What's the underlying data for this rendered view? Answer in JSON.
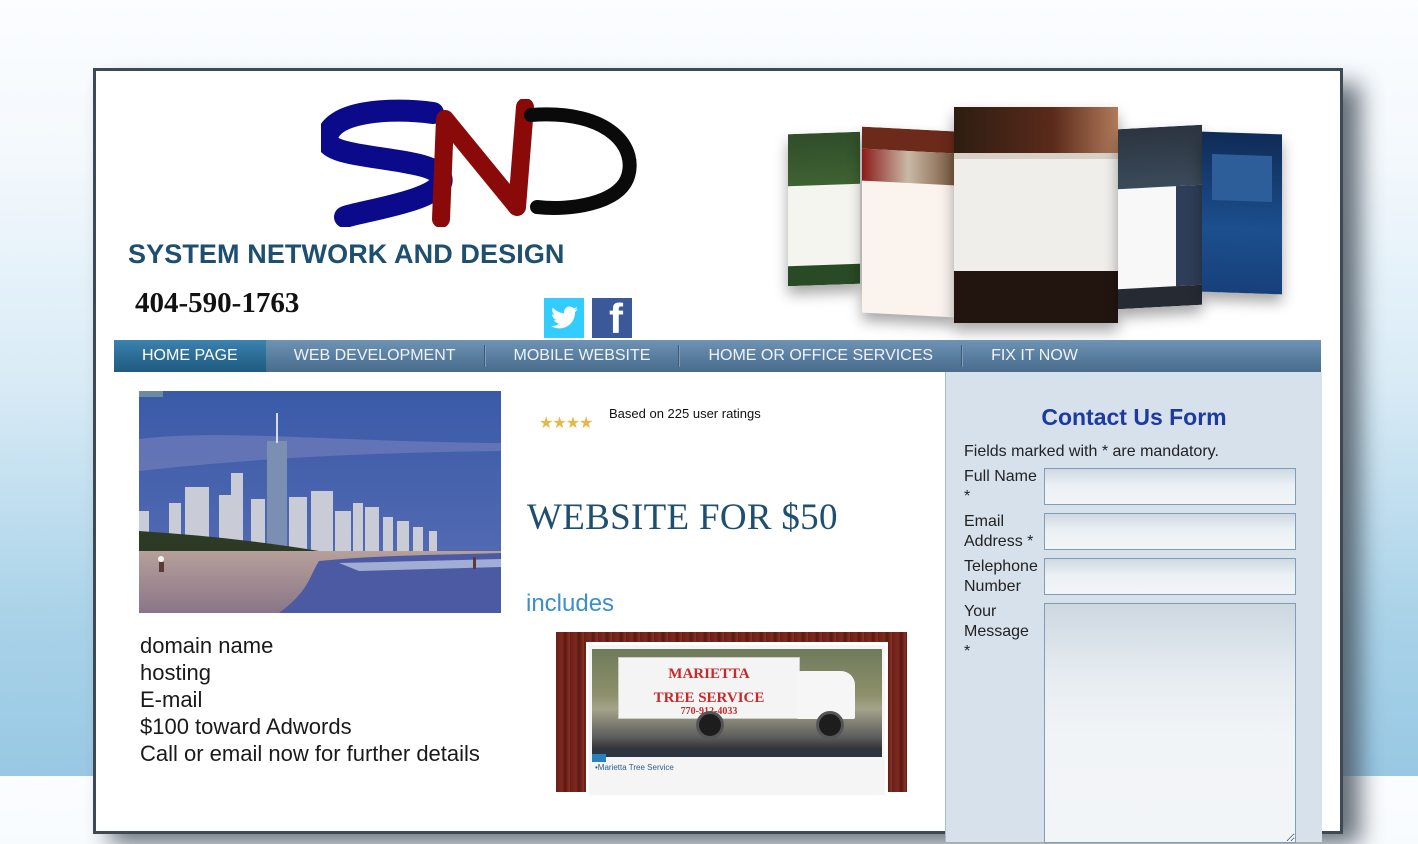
{
  "header": {
    "logo_letters": "SND",
    "site_title": "SYSTEM NETWORK AND DESIGN",
    "phone": "404-590-1763",
    "social": [
      {
        "name": "twitter",
        "icon": "twitter-bird-icon"
      },
      {
        "name": "facebook",
        "icon": "facebook-f-icon",
        "glyph": "f"
      }
    ]
  },
  "nav": {
    "items": [
      {
        "label": "HOME PAGE",
        "active": true
      },
      {
        "label": "WEB DEVELOPMENT",
        "active": false
      },
      {
        "label": "MOBILE WEBSITE",
        "active": false
      },
      {
        "label": "HOME OR OFFICE SERVICES",
        "active": false
      },
      {
        "label": "FIX IT NOW",
        "active": false
      }
    ]
  },
  "main": {
    "rating": {
      "stars_glyph": "★★★★",
      "stars": 4,
      "text": "Based on 225 user ratings"
    },
    "headline": "WEBSITE FOR $50",
    "includes_label": "includes",
    "includes_items": [
      "domain name",
      "hosting",
      "E-mail",
      "$100 toward Adwords",
      "Call or email now for further details"
    ],
    "promo": {
      "truck_title_1": "MARIETTA",
      "truck_title_2": "TREE SERVICE",
      "truck_phone": "770-912-4033",
      "caption": "•Marietta Tree Service"
    }
  },
  "contact_form": {
    "title": "Contact Us Form",
    "note": "Fields marked with * are mandatory.",
    "fields": [
      {
        "label": "Full Name *",
        "value": "",
        "type": "text"
      },
      {
        "label": "Email Address *",
        "value": "",
        "type": "text"
      },
      {
        "label": "Telephone Number",
        "value": "",
        "type": "text"
      },
      {
        "label": "Your Message *",
        "value": "",
        "type": "textarea"
      }
    ]
  },
  "colors": {
    "title_blue": "#1e4f6e",
    "form_title": "#1c3a9f",
    "includes_blue": "#3d8fcb",
    "nav_active": "#2b6d97",
    "nav_bg": "#5a7fa1",
    "form_bg": "#d7e1eb",
    "star_gold": "#e6b84a"
  }
}
